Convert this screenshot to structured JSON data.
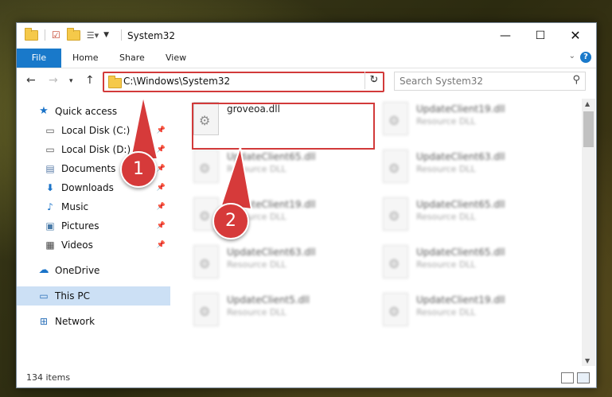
{
  "window": {
    "title": "System32"
  },
  "ribbon": {
    "tabs": [
      "File",
      "Home",
      "Share",
      "View"
    ]
  },
  "nav": {
    "address": "C:\\Windows\\System32",
    "search_placeholder": "Search System32"
  },
  "sidebar": {
    "items": [
      {
        "label": "Quick access",
        "icon": "star-icon"
      },
      {
        "label": "Local Disk (C:)",
        "icon": "drive-icon",
        "pinned": true
      },
      {
        "label": "Local Disk (D:)",
        "icon": "drive-icon",
        "pinned": true
      },
      {
        "label": "Documents",
        "icon": "documents-icon",
        "pinned": true
      },
      {
        "label": "Downloads",
        "icon": "download-icon",
        "pinned": true
      },
      {
        "label": "Music",
        "icon": "music-icon",
        "pinned": true
      },
      {
        "label": "Pictures",
        "icon": "pictures-icon",
        "pinned": true
      },
      {
        "label": "Videos",
        "icon": "videos-icon",
        "pinned": true
      },
      {
        "label": "OneDrive",
        "icon": "cloud-icon"
      },
      {
        "label": "This PC",
        "icon": "computer-icon",
        "selected": true
      },
      {
        "label": "Network",
        "icon": "network-icon"
      }
    ]
  },
  "files": [
    {
      "name": "groveoa.dll",
      "type": "",
      "blurred": false
    },
    {
      "name": "UpdateClient19.dll",
      "type": "Resource DLL",
      "blurred": true
    },
    {
      "name": "UpdateClient65.dll",
      "type": "Resource DLL",
      "blurred": true
    },
    {
      "name": "UpdateClient63.dll",
      "type": "Resource DLL",
      "blurred": true
    },
    {
      "name": "UpdateClient19.dll",
      "type": "Resource DLL",
      "blurred": true
    },
    {
      "name": "UpdateClient65.dll",
      "type": "Resource DLL",
      "blurred": true
    },
    {
      "name": "UpdateClient63.dll",
      "type": "Resource DLL",
      "blurred": true
    },
    {
      "name": "UpdateClient65.dll",
      "type": "Resource DLL",
      "blurred": true
    },
    {
      "name": "UpdateClient5.dll",
      "type": "Resource DLL",
      "blurred": true
    },
    {
      "name": "UpdateClient19.dll",
      "type": "Resource DLL",
      "blurred": true
    }
  ],
  "status": {
    "items": "134 items"
  },
  "annotations": [
    {
      "number": "1",
      "color": "#d63a3a"
    },
    {
      "number": "2",
      "color": "#d63a3a"
    }
  ]
}
